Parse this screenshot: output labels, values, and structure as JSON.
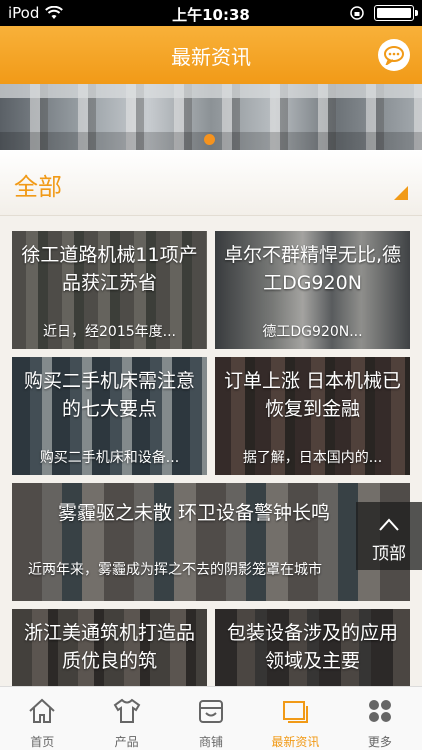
{
  "status_bar": {
    "carrier": "iPod",
    "time": "上午10:38"
  },
  "header": {
    "title": "最新资讯",
    "message_icon": "chat-bubble-icon"
  },
  "banner": {
    "active_dot_color": "#f5931e"
  },
  "category": {
    "label": "全部",
    "dropdown_icon": "triangle-corner-icon"
  },
  "news": [
    {
      "title": "徐工道路机械11项产品获江苏省",
      "summary": "近日，经2015年度..."
    },
    {
      "title": "卓尔不群精悍无比,德工DG920N",
      "summary": "德工DG920N..."
    },
    {
      "title": "购买二手机床需注意的七大要点",
      "summary": "购买二手机床和设备..."
    },
    {
      "title": "订单上涨 日本机械已恢复到金融",
      "summary": "据了解，日本国内的..."
    },
    {
      "title": "雾霾驱之未散 环卫设备警钟长鸣",
      "summary": "近两年来，雾霾成为挥之不去的阴影笼罩在城市"
    },
    {
      "title": "浙江美通筑机打造品质优良的筑",
      "summary": ""
    },
    {
      "title": "包装设备涉及的应用领域及主要",
      "summary": ""
    }
  ],
  "back_to_top": {
    "label": "顶部"
  },
  "tabs": [
    {
      "label": "首页",
      "icon": "home-icon"
    },
    {
      "label": "产品",
      "icon": "shirt-icon"
    },
    {
      "label": "商铺",
      "icon": "shop-icon"
    },
    {
      "label": "最新资讯",
      "icon": "news-icon",
      "active": true
    },
    {
      "label": "更多",
      "icon": "more-grid-icon"
    }
  ],
  "colors": {
    "accent": "#f19a17",
    "tab_inactive": "#666666"
  }
}
